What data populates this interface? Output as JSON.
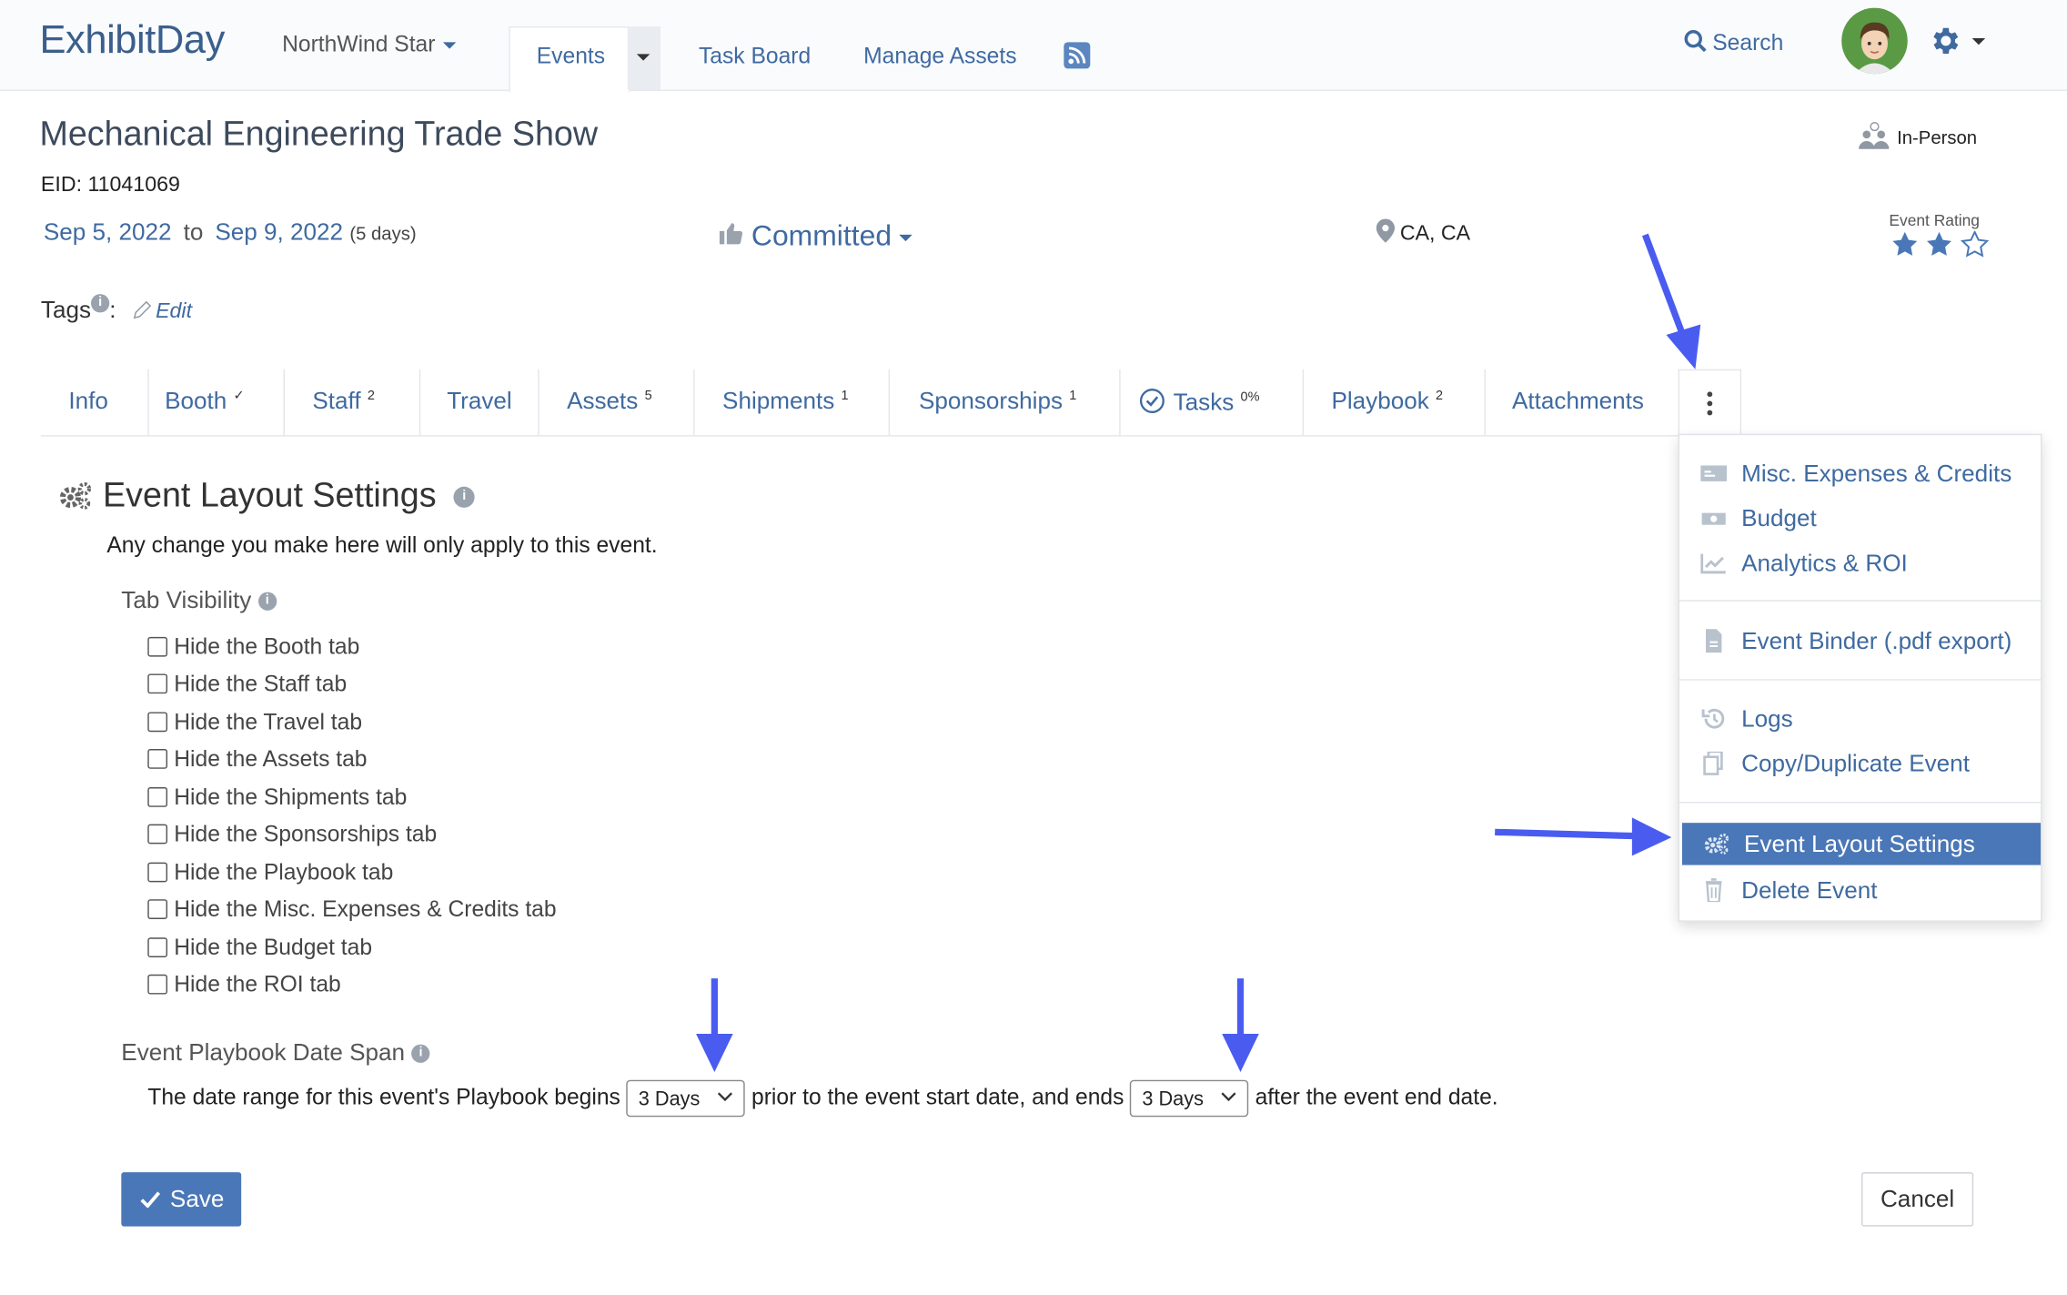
{
  "app": {
    "logo": "ExhibitDay",
    "org": "NorthWind Star",
    "nav": {
      "events": "Events",
      "task_board": "Task Board",
      "manage_assets": "Manage Assets"
    },
    "search_label": "Search"
  },
  "event": {
    "title": "Mechanical Engineering Trade Show",
    "eid": "EID: 11041069",
    "start": "Sep 5, 2022",
    "to": "to",
    "end": "Sep 9, 2022",
    "duration": "(5 days)",
    "status": "Committed",
    "location": "CA, CA",
    "format": "In-Person",
    "rating_label": "Event Rating",
    "rating": 2,
    "rating_max": 3,
    "tags_label": "Tags",
    "tags_colon": ":",
    "tags_edit": "Edit"
  },
  "tabs": [
    {
      "label": "Info",
      "badge": ""
    },
    {
      "label": "Booth",
      "badge": "✓"
    },
    {
      "label": "Staff",
      "badge": "2"
    },
    {
      "label": "Travel",
      "badge": ""
    },
    {
      "label": "Assets",
      "badge": "5"
    },
    {
      "label": "Shipments",
      "badge": "1"
    },
    {
      "label": "Sponsorships",
      "badge": "1"
    },
    {
      "label": "Tasks",
      "badge": "0%"
    },
    {
      "label": "Playbook",
      "badge": "2"
    },
    {
      "label": "Attachments",
      "badge": ""
    }
  ],
  "menu": {
    "misc": "Misc. Expenses & Credits",
    "budget": "Budget",
    "analytics": "Analytics & ROI",
    "binder": "Event Binder (.pdf export)",
    "logs": "Logs",
    "copy": "Copy/Duplicate Event",
    "layout": "Event Layout Settings",
    "delete": "Delete Event"
  },
  "settings": {
    "title": "Event Layout Settings",
    "note": "Any change you make here will only apply to this event.",
    "tab_visibility": "Tab Visibility",
    "checkboxes": [
      "Hide the Booth tab",
      "Hide the Staff tab",
      "Hide the Travel tab",
      "Hide the Assets tab",
      "Hide the Shipments tab",
      "Hide the Sponsorships tab",
      "Hide the Playbook tab",
      "Hide the Misc. Expenses & Credits tab",
      "Hide the Budget tab",
      "Hide the ROI tab"
    ],
    "date_span_title": "Event Playbook Date Span",
    "span_text_1": "The date range for this event's Playbook begins",
    "begins_value": "3 Days",
    "span_text_2": "prior to the event start date, and ends",
    "ends_value": "3 Days",
    "span_text_3": "after the event end date.",
    "save": "Save",
    "cancel": "Cancel"
  },
  "colors": {
    "accent": "#4a77b7",
    "link": "#3f6aa0",
    "annotation_arrow": "#4a5cf0"
  }
}
